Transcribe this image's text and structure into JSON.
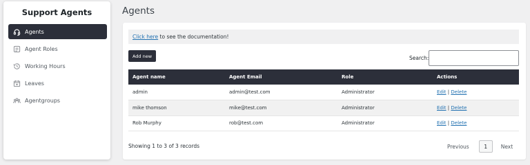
{
  "sidebar": {
    "title": "Support Agents",
    "items": [
      {
        "label": "Agents",
        "icon": "headset-icon",
        "active": true
      },
      {
        "label": "Agent Roles",
        "icon": "roles-icon",
        "active": false
      },
      {
        "label": "Working Hours",
        "icon": "clock-history-icon",
        "active": false
      },
      {
        "label": "Leaves",
        "icon": "calendar-icon",
        "active": false
      },
      {
        "label": "Agentgroups",
        "icon": "users-group-icon",
        "active": false
      }
    ]
  },
  "page": {
    "title": "Agents"
  },
  "notice": {
    "link_text": "Click here",
    "text": " to see the documentation!"
  },
  "toolbar": {
    "add_label": "Add new",
    "search_label": "Search:",
    "search_value": ""
  },
  "table": {
    "headers": [
      "Agent name",
      "Agent Email",
      "Role",
      "Actions"
    ],
    "rows": [
      {
        "name": "admin",
        "email": "admin@test.com",
        "role": "Administrator",
        "edit": "Edit",
        "sep": "|",
        "delete": "Delete"
      },
      {
        "name": "mike thomson",
        "email": "mike@test.com",
        "role": "Administrator",
        "edit": "Edit",
        "sep": "|",
        "delete": "Delete"
      },
      {
        "name": "Rob Murphy",
        "email": "rob@test.com",
        "role": "Administrator",
        "edit": "Edit",
        "sep": "|",
        "delete": "Delete"
      }
    ]
  },
  "footer": {
    "summary": "Showing 1 to 3 of 3 records"
  },
  "pagination": {
    "previous": "Previous",
    "current_page": "1",
    "next": "Next"
  },
  "colors": {
    "dark": "#2c2f3a",
    "link": "#2271b1",
    "background": "#f0f0f1"
  }
}
